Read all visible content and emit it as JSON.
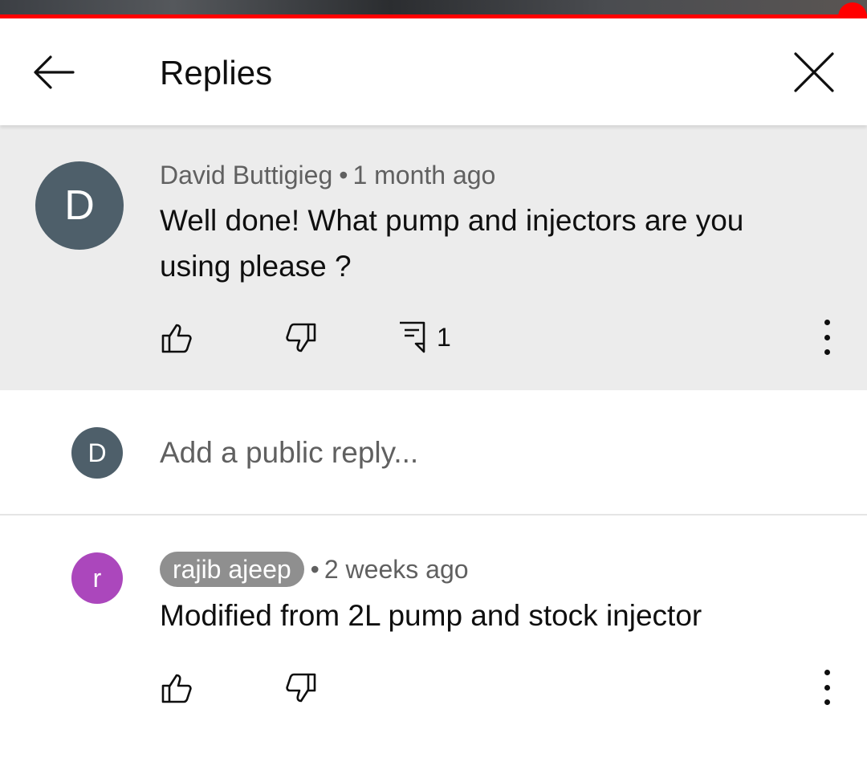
{
  "header": {
    "title": "Replies",
    "back_icon": "back-arrow-icon",
    "close_icon": "close-icon"
  },
  "player": {
    "progress": 0.983,
    "accent_color": "#ff0000"
  },
  "parent_comment": {
    "avatar_letter": "D",
    "avatar_color": "#4e5f6a",
    "author": "David Buttigieg",
    "separator": "•",
    "time": "1 month ago",
    "text_line1": "Well done! What pump and injectors are you",
    "text_line2": "using please ?",
    "reply_count": "1"
  },
  "reply_box": {
    "avatar_letter": "D",
    "avatar_color": "#4e5f6a",
    "placeholder": "Add a public reply..."
  },
  "reply": {
    "avatar_letter": "r",
    "avatar_color": "#ab47bc",
    "author": "rajib ajeep",
    "separator": "•",
    "time": "2 weeks ago",
    "text": "Modified from 2L pump and stock injector"
  }
}
